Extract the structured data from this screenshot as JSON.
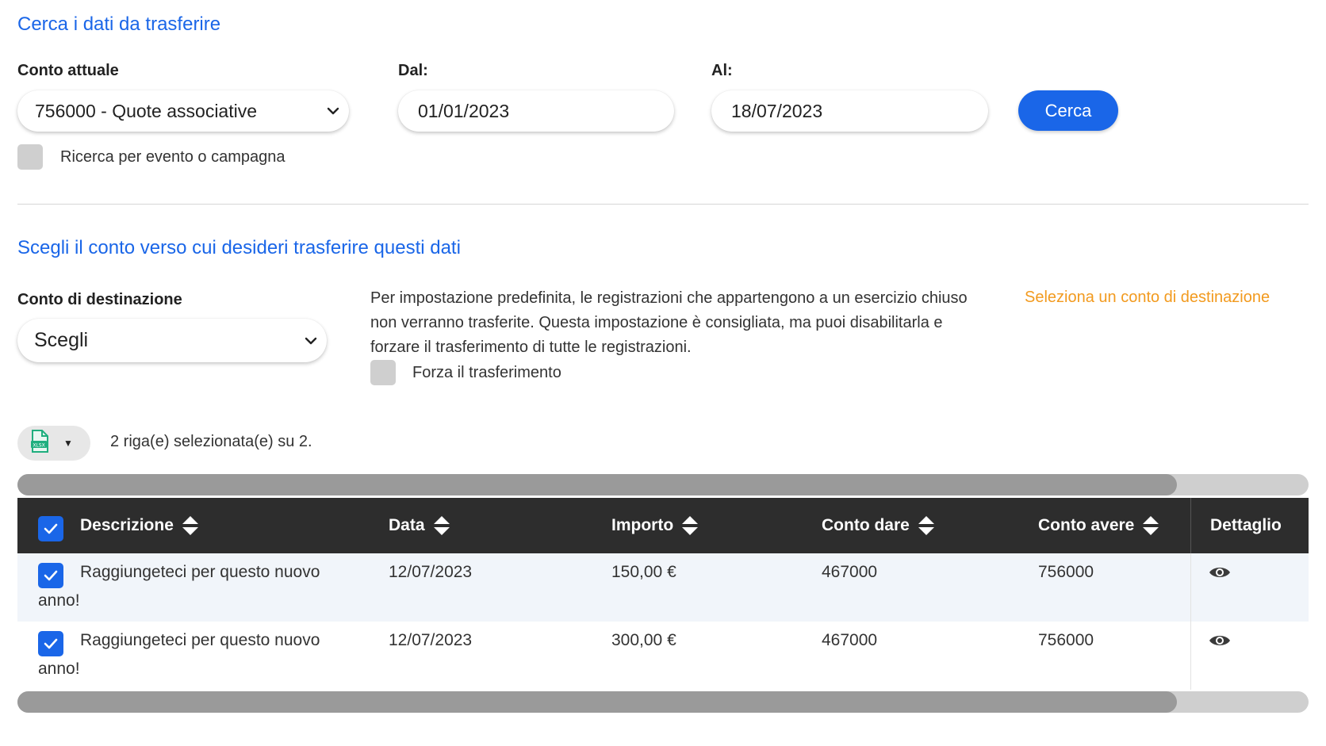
{
  "search": {
    "title": "Cerca i dati da trasferire",
    "account_label": "Conto attuale",
    "account_value": "756000 - Quote associative",
    "from_label": "Dal:",
    "from_value": "01/01/2023",
    "to_label": "Al:",
    "to_value": "18/07/2023",
    "search_button": "Cerca",
    "event_checkbox_label": "Ricerca per evento o campagna"
  },
  "destination": {
    "title": "Scegli il conto verso cui desideri trasferire questi dati",
    "label": "Conto di destinazione",
    "select_value": "Scegli",
    "info": "Per impostazione predefinita, le registrazioni che appartengono a un esercizio chiuso non verranno trasferite. Questa impostazione è consigliata, ma puoi disabilitarla e forzare il trasferimento di tutte le registrazioni.",
    "force_label": "Forza il trasferimento",
    "warning": "Seleziona un conto di destinazione"
  },
  "toolbar": {
    "export_icon": "xlsx-file-icon",
    "export_icon_text": "XLSX",
    "selection_text": "2 riga(e) selezionata(e) su 2."
  },
  "table": {
    "columns": {
      "descrizione": "Descrizione",
      "data": "Data",
      "importo": "Importo",
      "conto_dare": "Conto dare",
      "conto_avere": "Conto avere",
      "dettaglio": "Dettaglio"
    },
    "rows": [
      {
        "descrizione_line1": "Raggiungeteci per questo nuovo",
        "descrizione_line2": "anno!",
        "data": "12/07/2023",
        "importo": "150,00 €",
        "conto_dare": "467000",
        "conto_avere": "756000"
      },
      {
        "descrizione_line1": "Raggiungeteci per questo nuovo",
        "descrizione_line2": "anno!",
        "data": "12/07/2023",
        "importo": "300,00 €",
        "conto_dare": "467000",
        "conto_avere": "756000"
      }
    ]
  },
  "colors": {
    "accent": "#1a66e8",
    "warning": "#f29a1e",
    "table_header": "#2d2d2d",
    "export_icon": "#1fae7e"
  }
}
